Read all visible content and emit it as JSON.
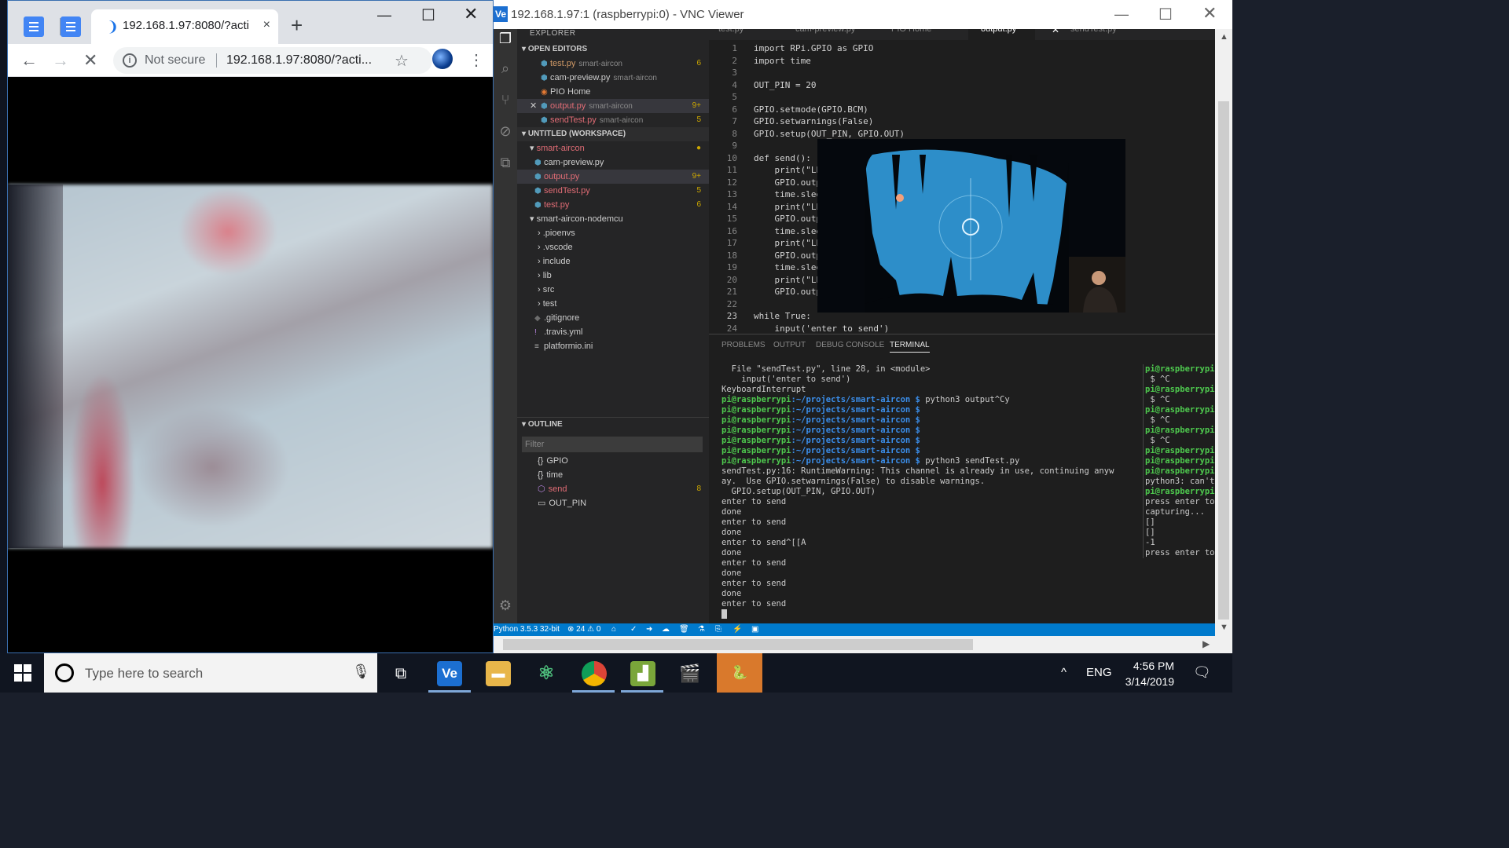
{
  "chrome": {
    "tab_title": "192.168.1.97:8080/?actio",
    "close_tab": "×",
    "new_tab": "+",
    "security": "Not secure",
    "url": "192.168.1.97:8080/?acti..."
  },
  "vnc": {
    "title": "192.168.1.97:1 (raspberrypi:0) - VNC Viewer",
    "logo": "Ve"
  },
  "explorer": {
    "header": "EXPLORER",
    "open_editors_label": "OPEN EDITORS",
    "open_editors": [
      {
        "name": "test.py",
        "desc": "smart-aircon",
        "count": "6"
      },
      {
        "name": "cam-preview.py",
        "desc": "smart-aircon",
        "count": ""
      },
      {
        "name": "PIO Home",
        "desc": "",
        "count": ""
      },
      {
        "name": "output.py",
        "desc": "smart-aircon",
        "count": "9+"
      },
      {
        "name": "sendTest.py",
        "desc": "smart-aircon",
        "count": "5"
      }
    ],
    "workspace_label": "UNTITLED (WORKSPACE)",
    "tree": [
      {
        "name": "smart-aircon",
        "count": "●"
      },
      {
        "name": "cam-preview.py",
        "count": ""
      },
      {
        "name": "output.py",
        "count": "9+"
      },
      {
        "name": "sendTest.py",
        "count": "5"
      },
      {
        "name": "test.py",
        "count": "6"
      },
      {
        "name": "smart-aircon-nodemcu",
        "count": ""
      },
      {
        "name": ".pioenvs",
        "count": ""
      },
      {
        "name": ".vscode",
        "count": ""
      },
      {
        "name": "include",
        "count": ""
      },
      {
        "name": "lib",
        "count": ""
      },
      {
        "name": "src",
        "count": ""
      },
      {
        "name": "test",
        "count": ""
      },
      {
        "name": ".gitignore",
        "count": ""
      },
      {
        "name": ".travis.yml",
        "count": ""
      },
      {
        "name": "platformio.ini",
        "count": ""
      }
    ],
    "outline_label": "OUTLINE",
    "filter_placeholder": "Filter",
    "outline": [
      {
        "name": "GPIO",
        "icon": "{}",
        "count": ""
      },
      {
        "name": "time",
        "icon": "{}",
        "count": ""
      },
      {
        "name": "send",
        "icon": "⬡",
        "count": "8"
      },
      {
        "name": "OUT_PIN",
        "icon": "▭",
        "count": ""
      }
    ]
  },
  "editor_tabs": [
    "test.py",
    "cam-preview.py",
    "PIO Home",
    "output.py",
    "sendTest.py"
  ],
  "code": {
    "line_numbers": [
      "1",
      "2",
      "3",
      "4",
      "5",
      "6",
      "7",
      "8",
      "9",
      "10",
      "11",
      "12",
      "13",
      "14",
      "15",
      "16",
      "17",
      "18",
      "19",
      "20",
      "21",
      "22",
      "23",
      "24"
    ],
    "lines": [
      "import RPi.GPIO as GPIO",
      "import time",
      "",
      "OUT_PIN = 20",
      "",
      "GPIO.setmode(GPIO.BCM)",
      "GPIO.setwarnings(False)",
      "GPIO.setup(OUT_PIN, GPIO.OUT)",
      "",
      "def send():",
      "    print(\"LE",
      "    GPIO.outp",
      "    time.slee",
      "    print(\"LE",
      "    GPIO.outp",
      "    time.slee",
      "    print(\"LE",
      "    GPIO.outp",
      "    time.slee",
      "    print(\"LE",
      "    GPIO.outp",
      "",
      "while True:",
      "    input('enter to send')"
    ]
  },
  "panel": {
    "tabs": [
      "PROBLEMS",
      "OUTPUT",
      "DEBUG CONSOLE",
      "TERMINAL"
    ],
    "terminal_lines": [
      {
        "p": "",
        "t": "  File \"sendTest.py\", line 28, in <module>"
      },
      {
        "p": "",
        "t": "    input('enter to send')"
      },
      {
        "p": "",
        "t": "KeyboardInterrupt"
      },
      {
        "p": "pi@raspberrypi",
        "d": ":~/projects/smart-aircon $",
        "t": " python3 output^Cy"
      },
      {
        "p": "pi@raspberrypi",
        "d": ":~/projects/smart-aircon $",
        "t": ""
      },
      {
        "p": "pi@raspberrypi",
        "d": ":~/projects/smart-aircon $",
        "t": ""
      },
      {
        "p": "pi@raspberrypi",
        "d": ":~/projects/smart-aircon $",
        "t": ""
      },
      {
        "p": "pi@raspberrypi",
        "d": ":~/projects/smart-aircon $",
        "t": ""
      },
      {
        "p": "pi@raspberrypi",
        "d": ":~/projects/smart-aircon $",
        "t": ""
      },
      {
        "p": "pi@raspberrypi",
        "d": ":~/projects/smart-aircon $",
        "t": " python3 sendTest.py"
      },
      {
        "p": "",
        "t": "sendTest.py:16: RuntimeWarning: This channel is already in use, continuing anyw"
      },
      {
        "p": "",
        "t": "ay.  Use GPIO.setwarnings(False) to disable warnings."
      },
      {
        "p": "",
        "t": "  GPIO.setup(OUT_PIN, GPIO.OUT)"
      },
      {
        "p": "",
        "t": "enter to send"
      },
      {
        "p": "",
        "t": "done"
      },
      {
        "p": "",
        "t": "enter to send"
      },
      {
        "p": "",
        "t": "done"
      },
      {
        "p": "",
        "t": "enter to send^[[A"
      },
      {
        "p": "",
        "t": "done"
      },
      {
        "p": "",
        "t": "enter to send"
      },
      {
        "p": "",
        "t": "done"
      },
      {
        "p": "",
        "t": "enter to send"
      },
      {
        "p": "",
        "t": "done"
      },
      {
        "p": "",
        "t": "enter to send"
      }
    ],
    "terminal2_lines": [
      {
        "p": "pi@raspberrypi",
        "t": ""
      },
      {
        "p": "",
        "t": " $ ^C"
      },
      {
        "p": "pi@raspberrypi",
        "t": ""
      },
      {
        "p": "",
        "t": " $ ^C"
      },
      {
        "p": "pi@raspberrypi",
        "t": ""
      },
      {
        "p": "",
        "t": " $ ^C"
      },
      {
        "p": "pi@raspberrypi",
        "t": ""
      },
      {
        "p": "",
        "t": " $ ^C"
      },
      {
        "p": "pi@raspberrypi",
        "t": ""
      },
      {
        "p": "pi@raspberrypi",
        "t": ""
      },
      {
        "p": "pi@raspberrypi",
        "t": ""
      },
      {
        "p": "",
        "t": "python3: can't"
      },
      {
        "p": "pi@raspberrypi",
        "t": ""
      },
      {
        "p": "",
        "t": "press enter to"
      },
      {
        "p": "",
        "t": "capturing..."
      },
      {
        "p": "",
        "t": "[]"
      },
      {
        "p": "",
        "t": "[]"
      },
      {
        "p": "",
        "t": "-1"
      },
      {
        "p": "",
        "t": "press enter to"
      }
    ]
  },
  "statusbar": {
    "python": "Python 3.5.3 32-bit",
    "errors": "24",
    "warnings": "0"
  },
  "taskbar": {
    "search_placeholder": "Type here to search",
    "lang": "ENG",
    "time": "4:56 PM",
    "date": "3/14/2019"
  },
  "colors": {
    "vscode_accent": "#007acc",
    "chrome_tab_bg": "#dee1e6",
    "taskbar_bg": "#101520"
  }
}
